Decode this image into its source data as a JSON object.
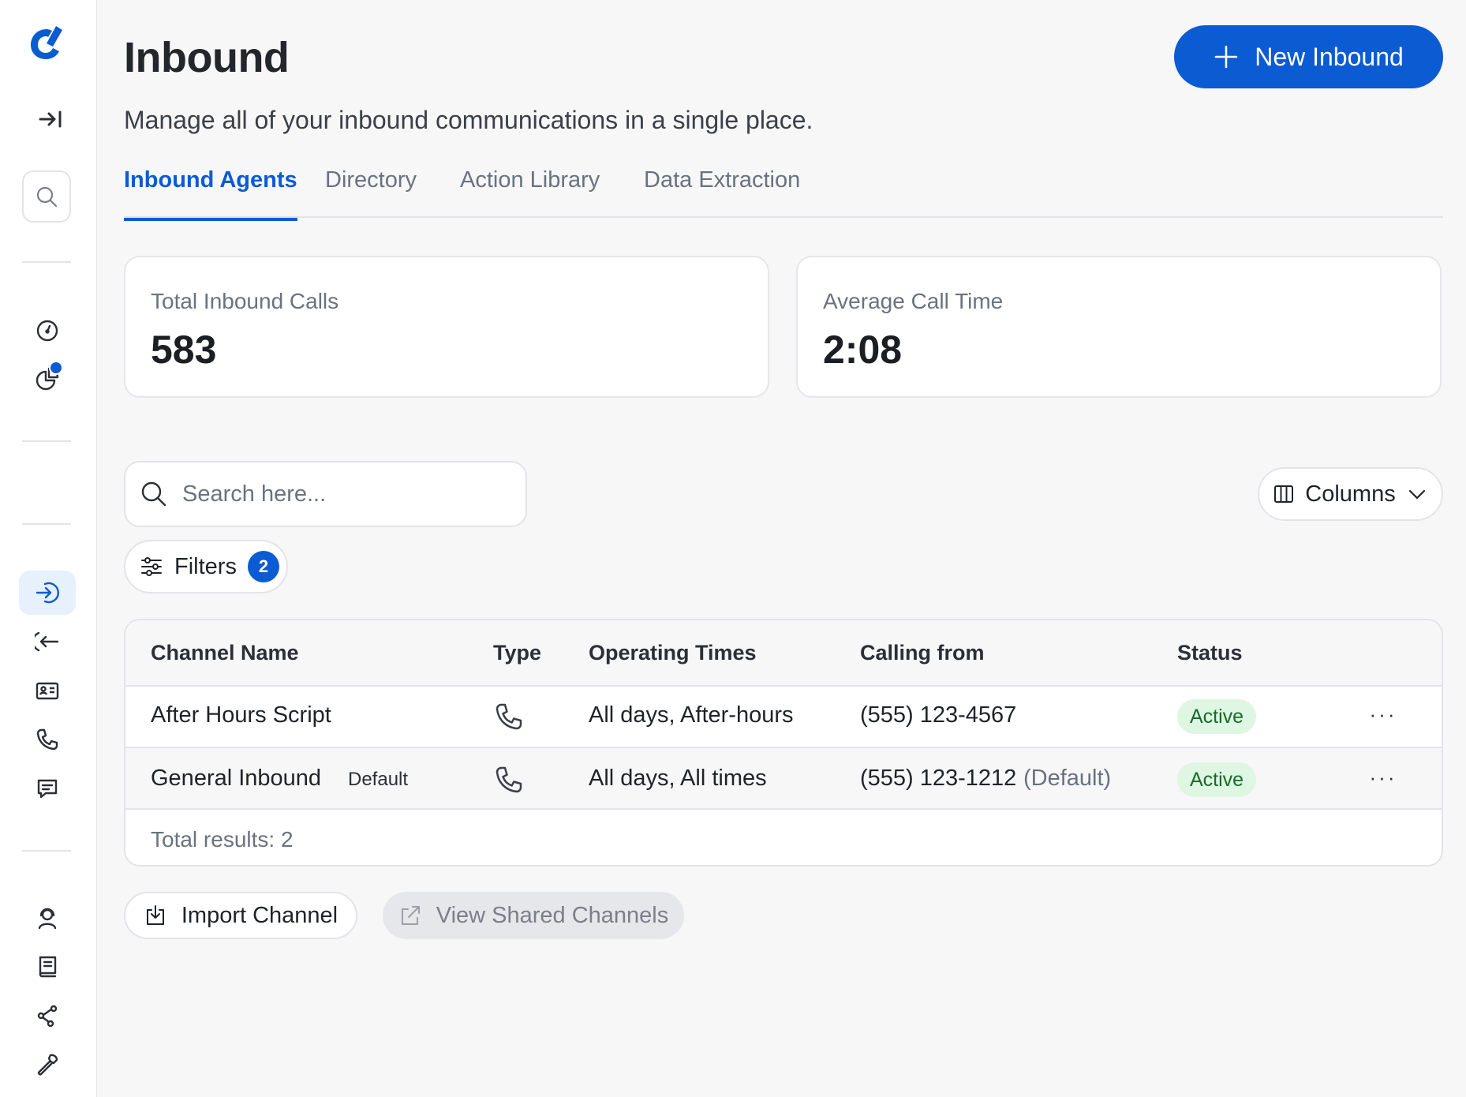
{
  "header": {
    "title": "Inbound",
    "subtitle": "Manage all of your inbound communications in a single place.",
    "new_button": "New Inbound"
  },
  "tabs": [
    {
      "label": "Inbound Agents",
      "active": true
    },
    {
      "label": "Directory",
      "active": false
    },
    {
      "label": "Action Library",
      "active": false
    },
    {
      "label": "Data Extraction",
      "active": false
    }
  ],
  "stats": [
    {
      "label": "Total Inbound Calls",
      "value": "583"
    },
    {
      "label": "Average Call Time",
      "value": "2:08"
    }
  ],
  "search": {
    "placeholder": "Search here..."
  },
  "columns_button": "Columns",
  "filters": {
    "label": "Filters",
    "count": "2"
  },
  "table": {
    "headers": [
      "Channel Name",
      "Type",
      "Operating Times",
      "Calling from",
      "Status"
    ],
    "rows": [
      {
        "name": "After Hours Script",
        "tag": "",
        "type_icon": "phone-icon",
        "times": "All days, After-hours",
        "calling": "(555) 123-4567",
        "calling_note": "",
        "status": "Active"
      },
      {
        "name": "General Inbound",
        "tag": "Default",
        "type_icon": "phone-icon",
        "times": "All days, All times",
        "calling": "(555) 123-1212",
        "calling_note": "(Default)",
        "status": "Active"
      }
    ],
    "more_label": "···",
    "total": "Total results: 2"
  },
  "actions": {
    "import": "Import Channel",
    "shared": "View Shared Channels"
  },
  "sidebar": {
    "icons": [
      "logo-icon",
      "collapse-icon",
      "search-icon",
      "gauge-icon",
      "pie-chart-icon",
      "inbound-icon",
      "outbound-icon",
      "contact-card-icon",
      "phone-icon",
      "message-icon",
      "agent-icon",
      "book-icon",
      "share-icon",
      "wrench-icon"
    ],
    "active_item": "inbound-icon"
  },
  "colors": {
    "accent": "#0b5bd3",
    "active_bg": "#e7f0fd",
    "status_bg": "#dff6e3",
    "status_text": "#166c2a",
    "page_bg": "#f7f7f8"
  }
}
